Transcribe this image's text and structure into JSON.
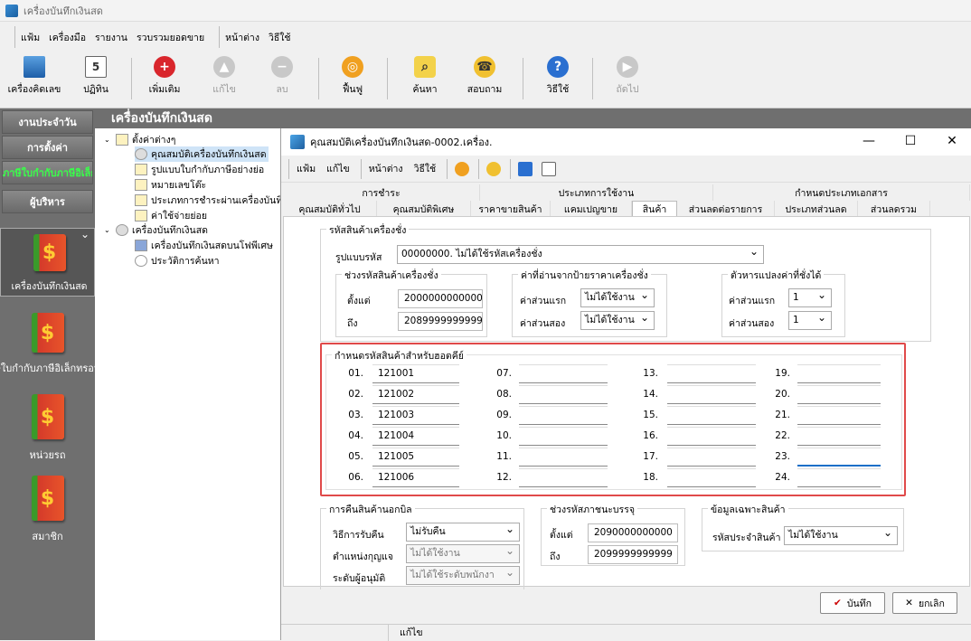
{
  "app": {
    "title": "เครื่องบันทึกเงินสด"
  },
  "menubar": [
    "แฟ้ม",
    "เครื่องมือ",
    "รายงาน",
    "รวบรวมยอดขาย",
    "หน้าต่าง",
    "วิธีใช้"
  ],
  "toolbar": {
    "calc": "เครื่องคิดเลข",
    "calendar": "ปฏิทิน",
    "add": "เพิ่มเติม",
    "edit": "แก้ไข",
    "delete": "ลบ",
    "refresh": "ฟื้นฟู",
    "search": "ค้นหา",
    "inquiry": "สอบถาม",
    "help": "วิธีใช้",
    "next": "ถัดไป"
  },
  "left": {
    "btn_daily": "งานประจำวัน",
    "btn_settings": "การตั้งค่า",
    "btn_einvoice": "ภาษีใบกำกับภาษีอิเล็กทรอนิกส์",
    "btn_admin": "ผู้บริหาร",
    "apps": [
      "เครื่องบันทึกเงินสด",
      "ภาษีใบกำกับภาษีอิเล็กทรอนิกส์",
      "หน่วยรถ",
      "สมาชิก"
    ]
  },
  "main": {
    "header": "เครื่องบันทึกเงินสด"
  },
  "tree": {
    "root1": "ตั้งค่าต่างๆ",
    "items1": [
      "คุณสมบัติเครื่องบันทึกเงินสด",
      "รูปแบบใบกำกับภาษีอย่างย่อ",
      "หมายเลขโต๊ะ",
      "ประเภทการชำระผ่านเครื่องบันทึก",
      "ค่าใช้จ่ายย่อย"
    ],
    "root2": "เครื่องบันทึกเงินสด",
    "items2": [
      "เครื่องบันทึกเงินสดบนโฟพีเศษ",
      "ประวัติการค้นหา"
    ]
  },
  "dialog": {
    "title": "คุณสมบัติเครื่องบันทึกเงินสด-0002.เครื่อง.",
    "menu": [
      "แฟ้ม",
      "แก้ไข",
      "หน้าต่าง",
      "วิธีใช้"
    ],
    "tabs_top": [
      "การชำระ",
      "ประเภทการใช้งาน",
      "กำหนดประเภทเอกสาร"
    ],
    "tabs_bottom": [
      "คุณสมบัติทั่วไป",
      "คุณสมบัติพิเศษ",
      "ราคาขายสินค้า",
      "แคมเปญขาย",
      "สินค้า",
      "ส่วนลดต่อรายการ",
      "ประเภทส่วนลด",
      "ส่วนลดรวม"
    ],
    "grp_code": "รหัสสินค้าเครื่องชั่ง",
    "format_label": "รูปแบบรหัส",
    "format_value": "00000000. ไม่ได้ใช้รหัสเครื่องชั่ง",
    "grp_range": "ช่วงรหัสสินค้าเครื่องชั่ง",
    "from_label": "ตั้งแต่",
    "from_value": "2000000000000",
    "to_label": "ถึง",
    "to_value": "2089999999999",
    "grp_read": "ค่าที่อ่านจากป้ายราคาเครื่องชั่ง",
    "first_label": "ค่าส่วนแรก",
    "first_value": "ไม่ได้ใช้งาน",
    "second_label": "ค่าส่วนสอง",
    "second_value": "ไม่ได้ใช้งาน",
    "grp_div": "ตัวหารแปลงค่าที่ชั่งได้",
    "div_first_label": "ค่าส่วนแรก",
    "div_first_value": "1",
    "div_second_label": "ค่าส่วนสอง",
    "div_second_value": "1",
    "grp_hotkey": "กำหนดรหัสสินค้าสำหรับฮอตคีย์",
    "hotkeys": [
      {
        "n": "01.",
        "v": "121001"
      },
      {
        "n": "02.",
        "v": "121002"
      },
      {
        "n": "03.",
        "v": "121003"
      },
      {
        "n": "04.",
        "v": "121004"
      },
      {
        "n": "05.",
        "v": "121005"
      },
      {
        "n": "06.",
        "v": "121006"
      },
      {
        "n": "07.",
        "v": ""
      },
      {
        "n": "08.",
        "v": ""
      },
      {
        "n": "09.",
        "v": ""
      },
      {
        "n": "10.",
        "v": ""
      },
      {
        "n": "11.",
        "v": ""
      },
      {
        "n": "12.",
        "v": ""
      },
      {
        "n": "13.",
        "v": ""
      },
      {
        "n": "14.",
        "v": ""
      },
      {
        "n": "15.",
        "v": ""
      },
      {
        "n": "16.",
        "v": ""
      },
      {
        "n": "17.",
        "v": ""
      },
      {
        "n": "18.",
        "v": ""
      },
      {
        "n": "19.",
        "v": ""
      },
      {
        "n": "20.",
        "v": ""
      },
      {
        "n": "21.",
        "v": ""
      },
      {
        "n": "22.",
        "v": ""
      },
      {
        "n": "23.",
        "v": ""
      },
      {
        "n": "24.",
        "v": ""
      }
    ],
    "grp_return": "การคืนสินค้านอกบิล",
    "return_method_label": "วิธีการรับคืน",
    "return_method_value": "ไม่รับคืน",
    "return_key_label": "ตำแหน่งกุญแจ",
    "return_key_value": "ไม่ได้ใช้งาน",
    "return_level_label": "ระดับผู้อนุมัติ",
    "return_level_value": "ไม่ได้ใช้ระดับพนักงา",
    "grp_pack": "ช่วงรหัสภาชนะบรรจุ",
    "pack_from_label": "ตั้งแต่",
    "pack_from_value": "2090000000000",
    "pack_to_label": "ถึง",
    "pack_to_value": "2099999999999",
    "grp_special": "ข้อมูลเฉพาะสินค้า",
    "special_label": "รหัสประจำสินค้า",
    "special_value": "ไม่ได้ใช้งาน",
    "ok": "บันทึก",
    "cancel": "ยกเลิก",
    "status": "แก้ไข"
  }
}
